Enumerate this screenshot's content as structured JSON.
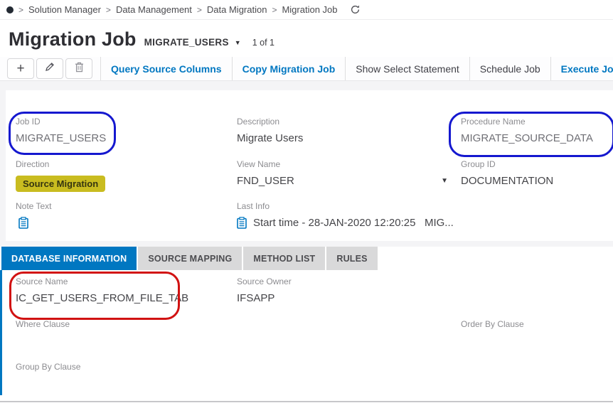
{
  "colors": {
    "accent_blue": "#0077c1",
    "badge_yellow": "#c9bc20",
    "annotation_blue": "#1518cf",
    "annotation_red": "#d11212",
    "tab_inactive_gray": "#d9d9da"
  },
  "breadcrumb": {
    "separator": ">",
    "items": [
      "Solution Manager",
      "Data Management",
      "Data Migration",
      "Migration Job"
    ]
  },
  "header": {
    "title": "Migration Job",
    "record_id": "MIGRATE_USERS",
    "record_caret": "▼",
    "record_position": "1 of 1"
  },
  "toolbar": {
    "add_glyph": "+",
    "buttons": [
      {
        "label": "Query Source Columns"
      },
      {
        "label": "Copy Migration Job"
      },
      {
        "label": "Show Select Statement"
      },
      {
        "label": "Schedule Job"
      },
      {
        "label": "Execute Job"
      }
    ]
  },
  "form": {
    "job_id": {
      "label": "Job ID",
      "value": "MIGRATE_USERS"
    },
    "description": {
      "label": "Description",
      "value": "Migrate Users"
    },
    "procedure_name": {
      "label": "Procedure Name",
      "value": "MIGRATE_SOURCE_DATA"
    },
    "direction": {
      "label": "Direction",
      "value": "Source Migration"
    },
    "view_name": {
      "label": "View Name",
      "value": "FND_USER",
      "caret": "▼"
    },
    "group_id": {
      "label": "Group ID",
      "value": "DOCUMENTATION"
    },
    "note_text": {
      "label": "Note Text"
    },
    "last_info": {
      "label": "Last Info",
      "value": "Start time - 28-JAN-2020 12:20:25   MIG..."
    }
  },
  "tabs": [
    {
      "label": "DATABASE INFORMATION",
      "active": true
    },
    {
      "label": "SOURCE MAPPING",
      "active": false
    },
    {
      "label": "METHOD LIST",
      "active": false
    },
    {
      "label": "RULES",
      "active": false
    }
  ],
  "database_information": {
    "source_name": {
      "label": "Source Name",
      "value": "IC_GET_USERS_FROM_FILE_TAB"
    },
    "source_owner": {
      "label": "Source Owner",
      "value": "IFSAPP"
    },
    "where_clause": {
      "label": "Where Clause",
      "value": ""
    },
    "order_by_clause": {
      "label": "Order By Clause",
      "value": ""
    },
    "group_by_clause": {
      "label": "Group By Clause",
      "value": ""
    }
  }
}
